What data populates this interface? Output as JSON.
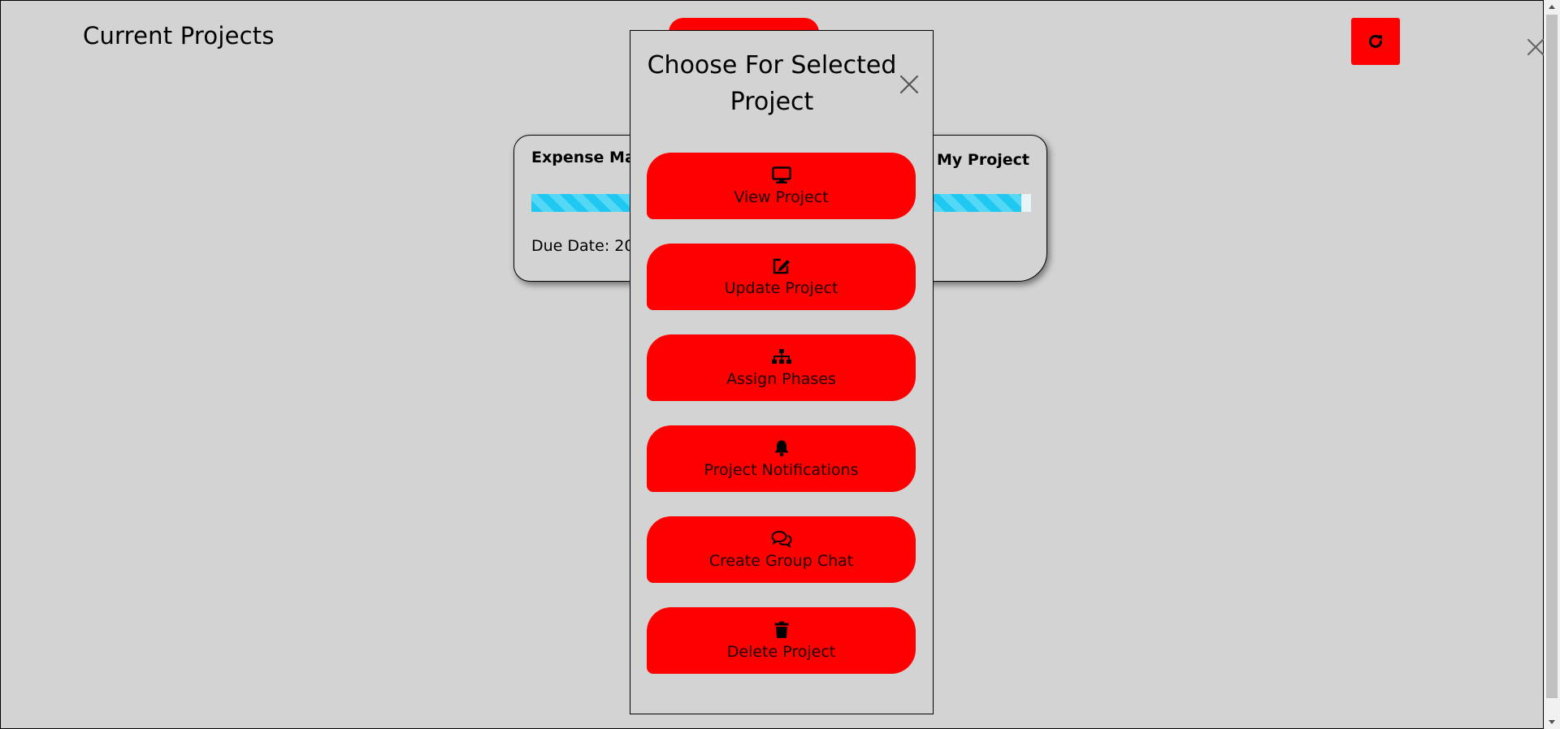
{
  "header": {
    "title": "Current Projects"
  },
  "icons": {
    "refresh": "refresh-icon",
    "close": "close-icon"
  },
  "colors": {
    "accent": "#ff0000",
    "background": "#d3d3d3",
    "progress": "#1ec8f0"
  },
  "project_card": {
    "name_left": "Expense Man",
    "name_right": "My Project",
    "progress": 0.98,
    "due_date": "Due Date: 202"
  },
  "modal": {
    "title": "Choose For Selected Project",
    "actions": [
      {
        "label": "View Project",
        "icon": "monitor-icon"
      },
      {
        "label": "Update Project",
        "icon": "edit-icon"
      },
      {
        "label": "Assign Phases",
        "icon": "sitemap-icon"
      },
      {
        "label": "Project Notifications",
        "icon": "bell-icon"
      },
      {
        "label": "Create Group Chat",
        "icon": "chat-icon"
      },
      {
        "label": "Delete Project",
        "icon": "trash-icon"
      }
    ]
  }
}
